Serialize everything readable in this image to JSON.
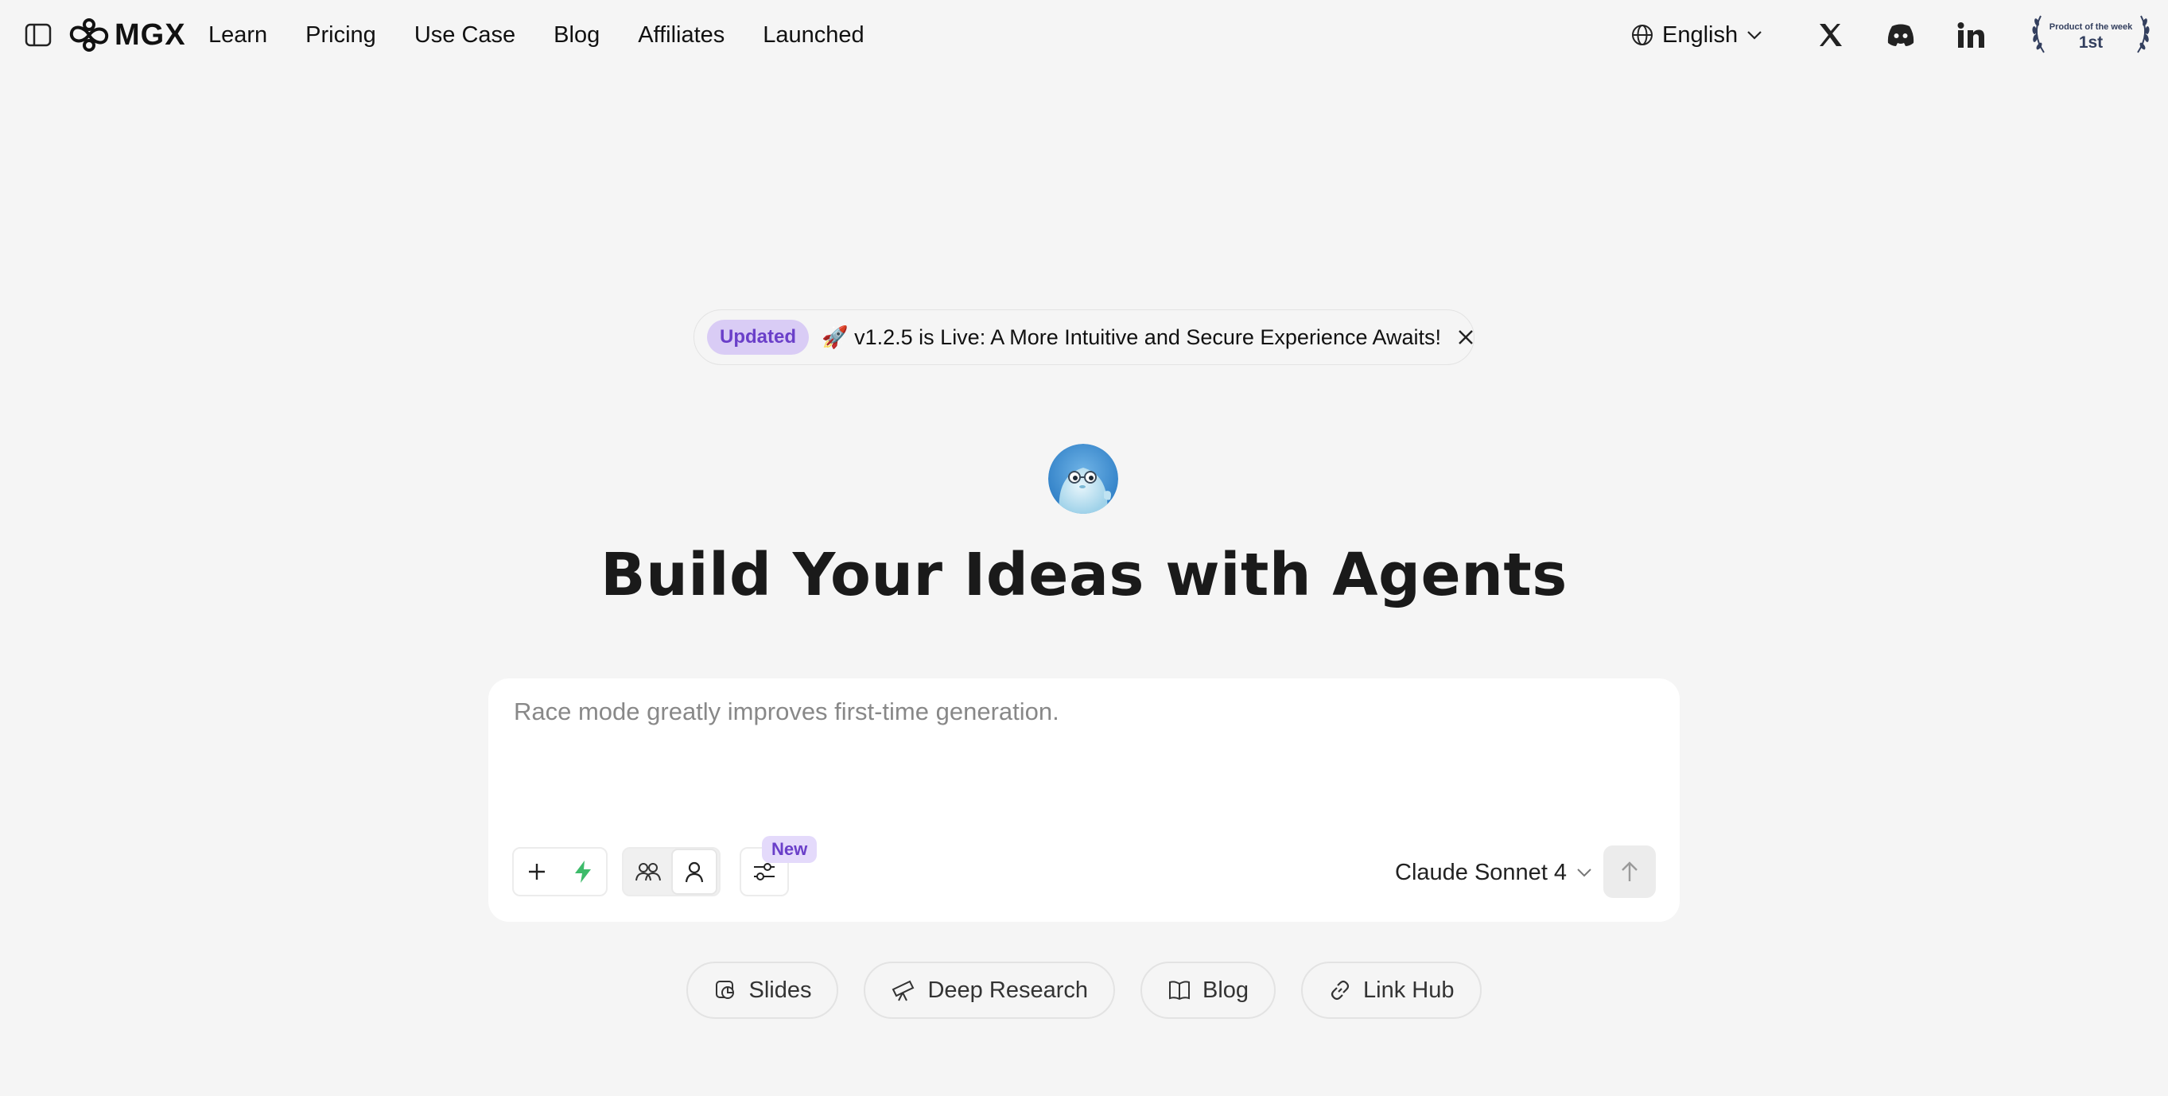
{
  "nav": {
    "logo_text": "MGX",
    "links": [
      "Learn",
      "Pricing",
      "Use Case",
      "Blog",
      "Affiliates",
      "Launched"
    ],
    "language": "English",
    "product_badge": {
      "line1": "Product of the week",
      "line2": "1st"
    }
  },
  "announcement": {
    "tag": "Updated",
    "text": "🚀 v1.2.5 is Live: A More Intuitive and Secure Experience Awaits!"
  },
  "hero": {
    "headline": "Build Your Ideas with Agents"
  },
  "prompt": {
    "placeholder": "Race mode greatly improves first-time generation.",
    "new_tag": "New",
    "model": "Claude Sonnet 4"
  },
  "chips": [
    "Slides",
    "Deep Research",
    "Blog",
    "Link Hub"
  ],
  "colors": {
    "background": "#f5f5f5",
    "accent_purple": "#6a3fc9",
    "tag_bg": "#d9ccf5",
    "bolt_green": "#3dbb6a"
  }
}
